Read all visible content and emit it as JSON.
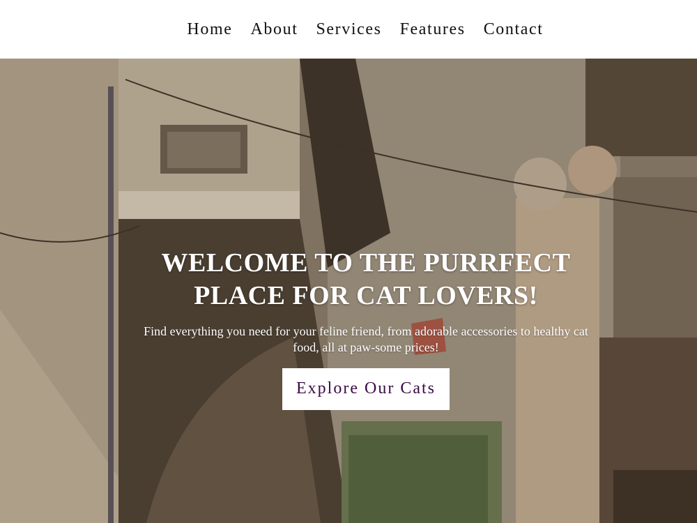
{
  "nav": {
    "items": [
      {
        "label": "Home"
      },
      {
        "label": "About"
      },
      {
        "label": "Services"
      },
      {
        "label": "Features"
      },
      {
        "label": "Contact"
      }
    ]
  },
  "hero": {
    "title": "WELCOME TO THE PURRFECT PLACE FOR CAT LOVERS!",
    "subtitle": "Find everything you need for your feline friend, from adorable accessories to healthy cat food, all at paw-some prices!",
    "cta_label": "Explore Our Cats",
    "cta_text_color": "#3b0a45"
  }
}
